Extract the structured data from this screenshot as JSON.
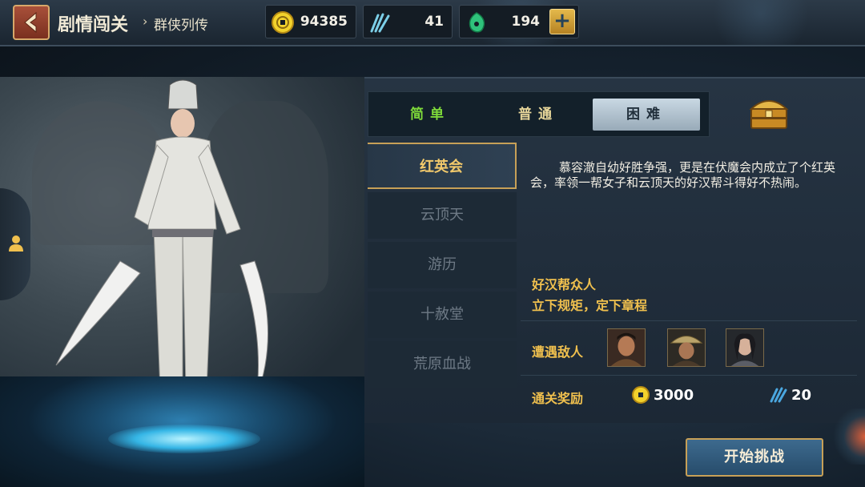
{
  "header": {
    "title": "剧情闯关",
    "breadcrumb_arrow": "›",
    "breadcrumb": "群侠列传"
  },
  "resources": [
    {
      "icon": "gold-coin-icon",
      "value": "94385"
    },
    {
      "icon": "feather-icon",
      "value": "41"
    },
    {
      "icon": "jade-icon",
      "value": "194"
    }
  ],
  "add_label": "+",
  "difficulty": {
    "tabs": [
      "简单",
      "普通",
      "困难"
    ],
    "selected": "困难"
  },
  "stages": [
    "红英会",
    "云顶天",
    "游历",
    "十赦堂",
    "荒原血战"
  ],
  "selected_stage": "红英会",
  "detail": {
    "description": "慕容澈自幼好胜争强，更是在伏魔会内成立了个红英会，率领一帮女子和云顶天的好汉帮斗得好不热闹。",
    "enemy_group_title": "好汉帮众人",
    "enemy_group_subtitle": "立下规矩，定下章程",
    "enemies_label": "遭遇敌人",
    "enemies": [
      "enemy-portrait-1",
      "enemy-portrait-2",
      "enemy-portrait-3"
    ],
    "rewards_label": "通关奖励",
    "rewards": [
      {
        "icon": "gold-coin-icon",
        "value": "3000"
      },
      {
        "icon": "feather-icon",
        "value": "20"
      }
    ]
  },
  "start_button": "开始挑战",
  "colors": {
    "accent_gold": "#c7a057",
    "easy_green": "#7ed93a",
    "label_yellow": "#f0c04e"
  }
}
